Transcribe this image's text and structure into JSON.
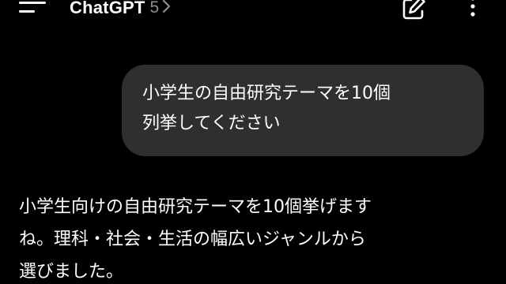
{
  "header": {
    "title": "ChatGPT",
    "version": "5",
    "icons": {
      "menu": "menu-icon",
      "chevron": "chevron-right-icon",
      "edit": "edit-icon",
      "more": "more-vertical-icon"
    }
  },
  "conversation": {
    "user_message": "小学生の自由研究テーマを10個\n列挙してください",
    "assistant_message": "小学生向けの自由研究テーマを10個挙げます\nね。理科・社会・生活の幅広いジャンルから\n選びました。"
  },
  "colors": {
    "background": "#000000",
    "bubble": "#2f2f2f",
    "text": "#ffffff",
    "muted": "#8e8e8e"
  }
}
